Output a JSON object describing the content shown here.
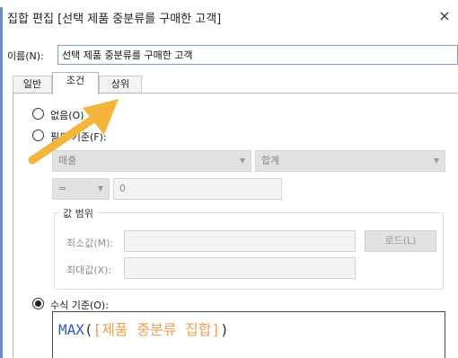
{
  "dialog": {
    "title": "집합 편집 [선택 제품 중분류를 구매한 고객]",
    "close_glyph": "×"
  },
  "name": {
    "label": "이름(N):",
    "value": "선택 제품 중분류를 구매한 고객"
  },
  "tabs": [
    {
      "label": "일반",
      "active": false
    },
    {
      "label": "조건",
      "active": true
    },
    {
      "label": "상위",
      "active": false
    }
  ],
  "condition": {
    "options": {
      "none_label": "없음(O)",
      "by_field_label": "필드 기준(F):",
      "by_formula_label": "수식 기준(O):"
    },
    "selected_option": "by_formula",
    "field_select_value": "매출",
    "aggregate_select_value": "합계",
    "operator_value": "=",
    "compare_value": "0",
    "value_range": {
      "title": "값 범위",
      "min_label": "최소값(M):",
      "max_label": "최대값(X):",
      "load_button_label": "로드(L)"
    },
    "formula": {
      "function": "MAX",
      "open_paren": "(",
      "field": "[제품 중분류 집합]",
      "close_paren": ")"
    }
  },
  "annotation": {
    "arrow_color": "#f5b43c"
  },
  "colors": {
    "formula_function": "#2f57c4",
    "formula_field": "#f0a050",
    "accent_border": "#6c8ebf"
  }
}
